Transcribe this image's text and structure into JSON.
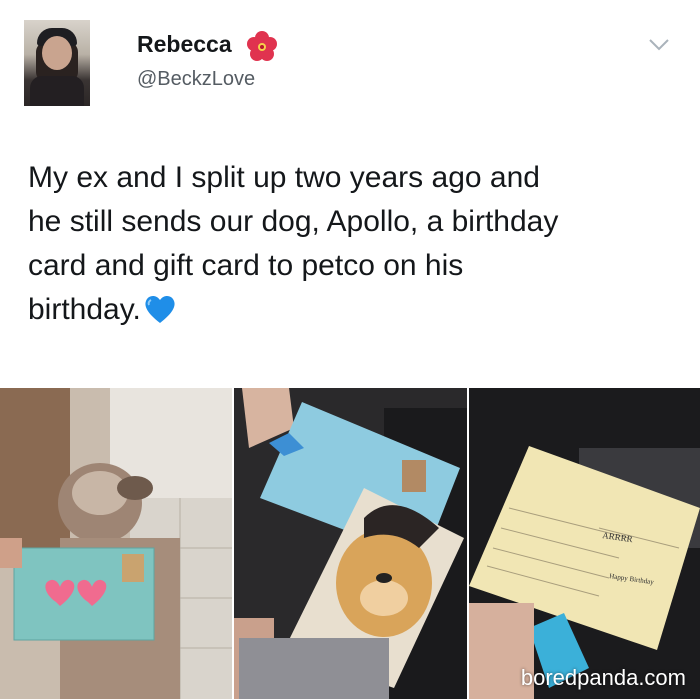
{
  "user": {
    "name": "Rebecca",
    "handle": "@BeckzLove"
  },
  "tweet": {
    "lines": [
      "My ex and I split up two years ago and",
      "he still sends our dog, Apollo, a birthday",
      "card and gift card to petco on his",
      "birthday."
    ]
  },
  "icons": {
    "flower": "hibiscus-flower-icon",
    "heart": "blue-heart-icon",
    "menu": "chevron-down-icon"
  },
  "colors": {
    "text": "#14171a",
    "handle": "#555c63",
    "heart": "#1f8ee8",
    "flower": "#e0334f"
  },
  "photos": [
    {
      "caption": "dog-holding-card"
    },
    {
      "caption": "envelope-and-dog-card"
    },
    {
      "caption": "open-birthday-card"
    }
  ],
  "watermark": "boredpanda.com"
}
